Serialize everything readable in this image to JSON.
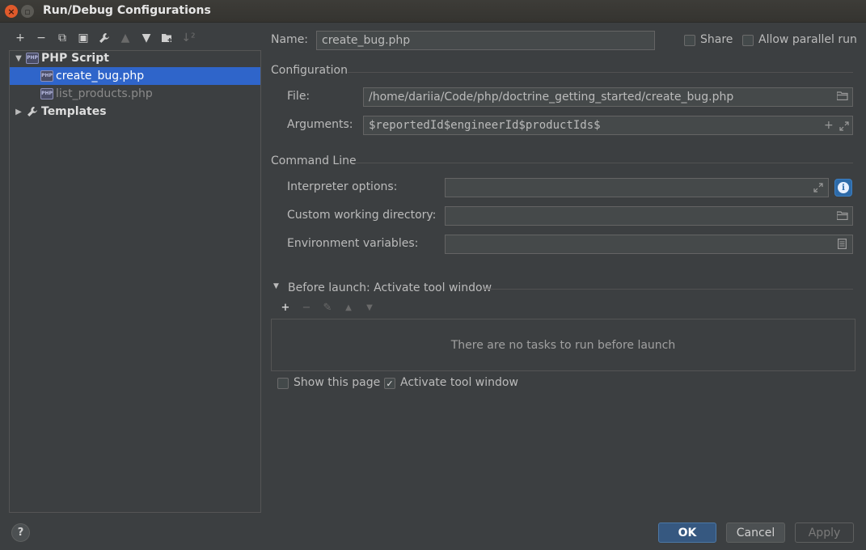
{
  "window": {
    "title": "Run/Debug Configurations"
  },
  "toolbar": {
    "add": "+",
    "remove": "−",
    "copy": "⧉",
    "save": "▣",
    "edit_defaults": "🔧",
    "move_up": "▲",
    "move_down": "▼",
    "new_folder": "▰",
    "sort": "↓²"
  },
  "tree": {
    "group_label": "PHP Script",
    "items": [
      {
        "label": "create_bug.php"
      },
      {
        "label": "list_products.php"
      }
    ],
    "templates_label": "Templates",
    "php_icon_text": "PHP"
  },
  "form": {
    "name_label": "Name:",
    "name_value": "create_bug.php",
    "share_label": "Share",
    "share_checked": false,
    "parallel_label": "Allow parallel run",
    "parallel_checked": false,
    "configuration_header": "Configuration",
    "file_label": "File:",
    "file_value": "/home/dariia/Code/php/doctrine_getting_started/create_bug.php",
    "arguments_label": "Arguments:",
    "arguments_value": "$reportedId$engineerId$productIds$",
    "command_line_header": "Command Line",
    "interpreter_label": "Interpreter options:",
    "interpreter_value": "",
    "workdir_label": "Custom working directory:",
    "workdir_value": "",
    "env_label": "Environment variables:",
    "env_value": ""
  },
  "before_launch": {
    "header": "Before launch: Activate tool window",
    "empty_text": "There are no tasks to run before launch",
    "show_page_label": "Show this page",
    "show_page_checked": false,
    "activate_label": "Activate tool window",
    "activate_checked": true
  },
  "buttons": {
    "help": "?",
    "ok": "OK",
    "cancel": "Cancel",
    "apply": "Apply"
  },
  "colors": {
    "selection": "#2f65ca",
    "background": "#3c3f41",
    "ok_button": "#365880"
  }
}
